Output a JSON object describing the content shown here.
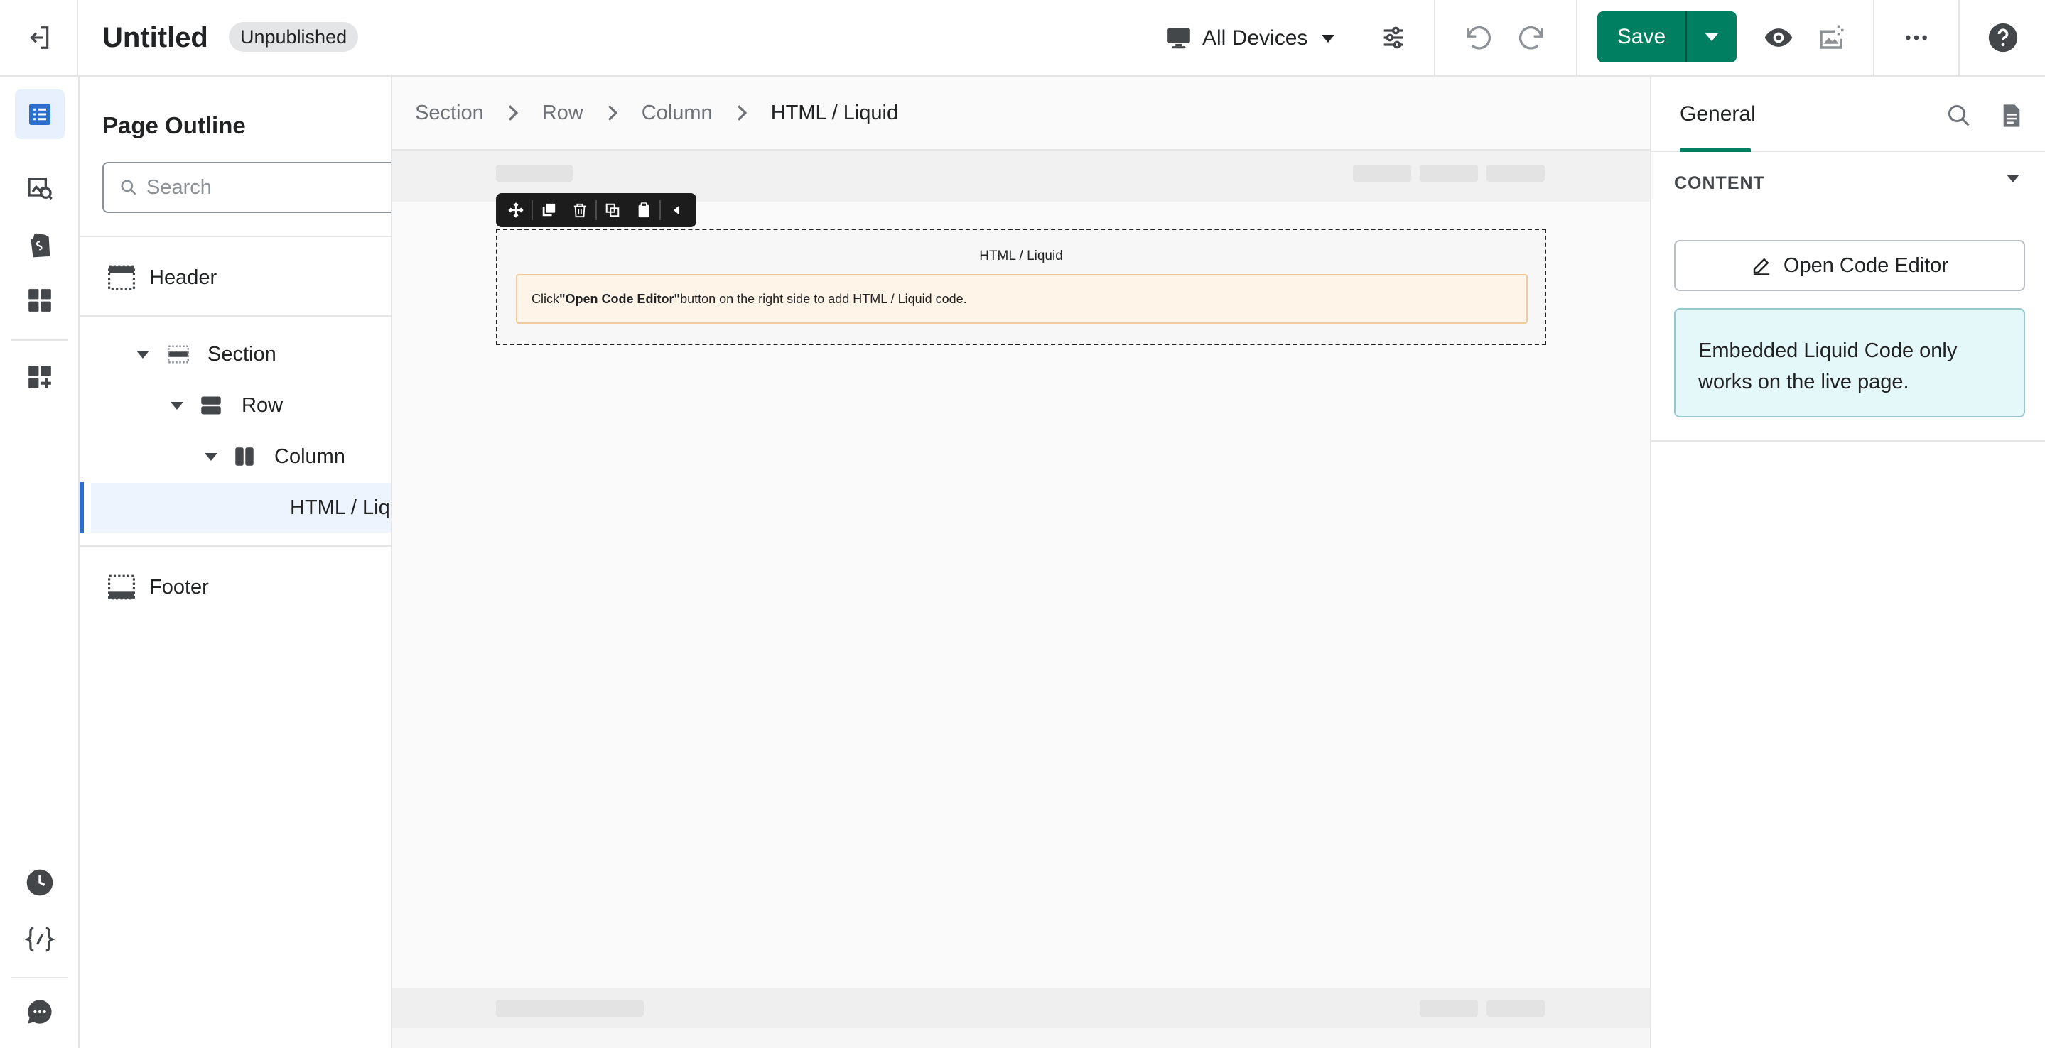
{
  "topbar": {
    "page_title": "Untitled",
    "status_badge": "Unpublished",
    "device_selector": "All Devices",
    "save_label": "Save"
  },
  "outline": {
    "title": "Page Outline",
    "search_placeholder": "Search",
    "items": [
      {
        "label": "Header"
      },
      {
        "label": "Section"
      },
      {
        "label": "Row"
      },
      {
        "label": "Column"
      },
      {
        "label": "HTML / Liquid"
      },
      {
        "label": "Footer"
      }
    ]
  },
  "breadcrumb": [
    "Section",
    "Row",
    "Column",
    "HTML / Liquid"
  ],
  "canvas": {
    "block_label": "HTML / Liquid",
    "msg_prefix": "Click",
    "msg_bold": "\"Open Code Editor\"",
    "msg_suffix": "button on the right side to add HTML / Liquid code."
  },
  "settings": {
    "tab": "General",
    "section_title": "CONTENT",
    "open_editor_label": "Open Code Editor",
    "note": "Embedded Liquid Code only works on the live page."
  },
  "colors": {
    "primary": "#008060",
    "accent_blue": "#2c6ecb",
    "note_bg": "#e4f8fa",
    "warning_bg": "#fff4e8"
  }
}
